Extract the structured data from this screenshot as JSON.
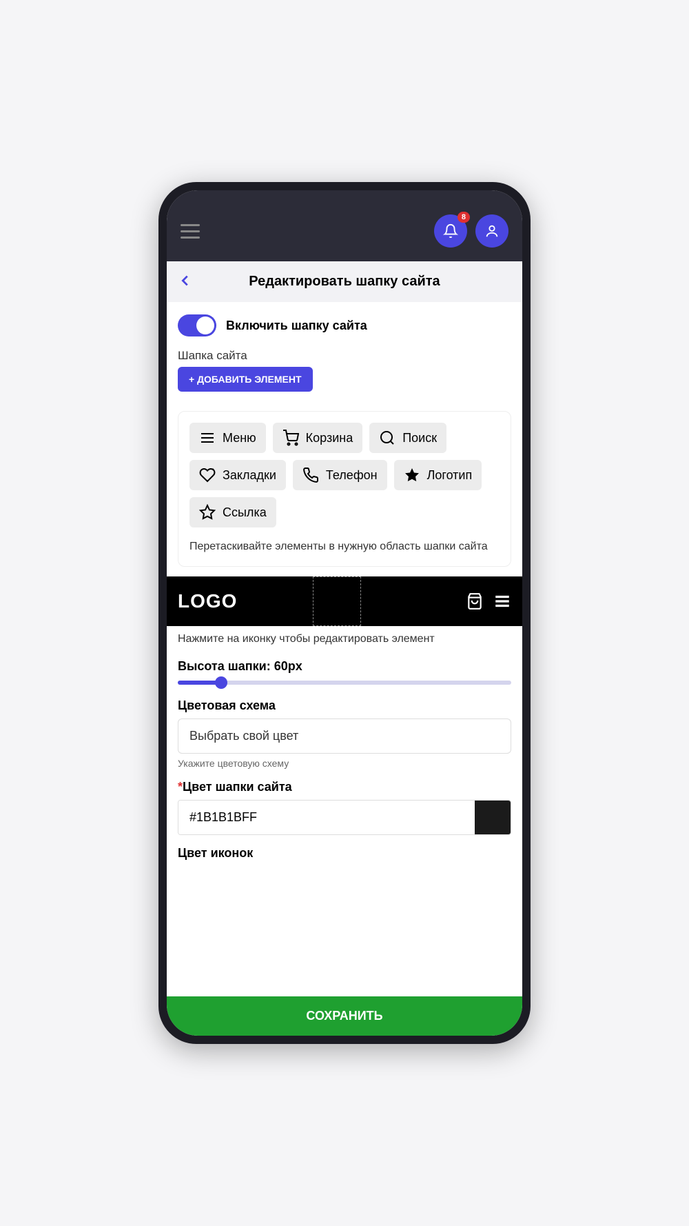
{
  "header": {
    "badge_count": "8"
  },
  "page": {
    "title": "Редактировать шапку сайта",
    "toggle_label": "Включить шапку сайта",
    "section_label": "Шапка сайта",
    "add_button": "+ ДОБАВИТЬ ЭЛЕМЕНТ",
    "elements_hint": "Перетаскивайте элементы в нужную область шапки сайта",
    "preview_hint": "Нажмите на иконку чтобы редактировать элемент",
    "logo_text": "LOGO",
    "save_button": "СОХРАНИТЬ"
  },
  "elements": {
    "menu": "Меню",
    "cart": "Корзина",
    "search": "Поиск",
    "bookmarks": "Закладки",
    "phone": "Телефон",
    "logo": "Логотип",
    "link": "Ссылка"
  },
  "height": {
    "label": "Высота шапки: 60px",
    "value": 60,
    "min": 0,
    "max": 460
  },
  "color_scheme": {
    "label": "Цветовая схема",
    "selected": "Выбрать свой цвет",
    "helper": "Укажите цветовую схему"
  },
  "header_color": {
    "label": "Цвет шапки сайта",
    "value": "#1B1B1BFF"
  },
  "icon_color": {
    "label": "Цвет иконок"
  }
}
